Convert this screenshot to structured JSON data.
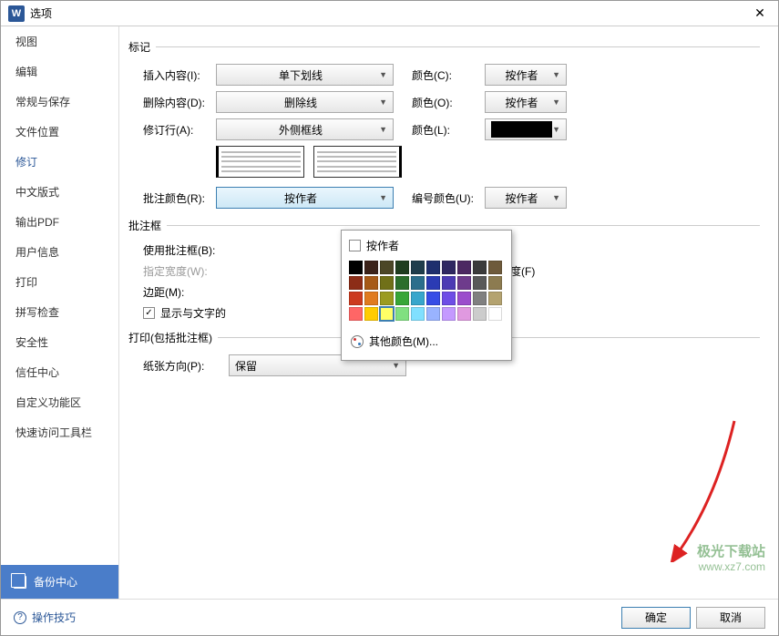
{
  "titlebar": {
    "icon_letter": "W",
    "title": "选项",
    "close": "✕"
  },
  "sidebar": {
    "items": [
      {
        "label": "视图"
      },
      {
        "label": "编辑"
      },
      {
        "label": "常规与保存"
      },
      {
        "label": "文件位置"
      },
      {
        "label": "修订"
      },
      {
        "label": "中文版式"
      },
      {
        "label": "输出PDF"
      },
      {
        "label": "用户信息"
      },
      {
        "label": "打印"
      },
      {
        "label": "拼写检查"
      },
      {
        "label": "安全性"
      },
      {
        "label": "信任中心"
      },
      {
        "label": "自定义功能区"
      },
      {
        "label": "快速访问工具栏"
      }
    ],
    "active_index": 4,
    "backup": "备份中心"
  },
  "sections": {
    "mark": "标记",
    "ballon": "批注框",
    "print": "打印(包括批注框)"
  },
  "mark": {
    "insert_label": "插入内容(I):",
    "insert_value": "单下划线",
    "delete_label": "删除内容(D):",
    "delete_value": "删除线",
    "revline_label": "修订行(A):",
    "revline_value": "外侧框线",
    "color_c_label": "颜色(C):",
    "color_o_label": "颜色(O):",
    "color_l_label": "颜色(L):",
    "by_author": "按作者",
    "comment_color_label": "批注颜色(R):",
    "comment_color_value": "按作者",
    "number_color_label": "编号颜色(U):"
  },
  "ballon": {
    "use_label": "使用批注框(B):",
    "width_label": "指定宽度(W):",
    "margin_label": "边距(M):",
    "recommend": "使用推荐宽度(F)",
    "show_line": "显示与文字的"
  },
  "print": {
    "orient_label": "纸张方向(P):",
    "orient_value": "保留"
  },
  "color_dropdown": {
    "by_author": "按作者",
    "more_colors": "其他颜色(M)...",
    "palette": [
      [
        "#000000",
        "#3b2219",
        "#4c4727",
        "#1f3d1f",
        "#1f3d4c",
        "#1f2f6e",
        "#2f2862",
        "#4c2862",
        "#3b3b3b",
        "#6e5a3b"
      ],
      [
        "#8c2d17",
        "#a65a17",
        "#707018",
        "#2b6e2b",
        "#2b6e8c",
        "#2b3bb4",
        "#4c3bb4",
        "#6e3b8c",
        "#595959",
        "#8c7b50"
      ],
      [
        "#cc3b1f",
        "#e07b1f",
        "#9b9b20",
        "#37a637",
        "#37a6cc",
        "#374de6",
        "#6e4de6",
        "#9b4dcc",
        "#808080",
        "#b4a370"
      ],
      [
        "#ff6666",
        "#ffcc00",
        "#ffff66",
        "#80e080",
        "#80e0ff",
        "#99b3ff",
        "#c499ff",
        "#e099e0",
        "#cccccc",
        "#ffffff"
      ]
    ],
    "selected": [
      3,
      2
    ]
  },
  "footer": {
    "tips": "操作技巧",
    "ok": "确定",
    "cancel": "取消"
  },
  "watermark": {
    "line1": "极光下载站",
    "line2": "www.xz7.com"
  }
}
